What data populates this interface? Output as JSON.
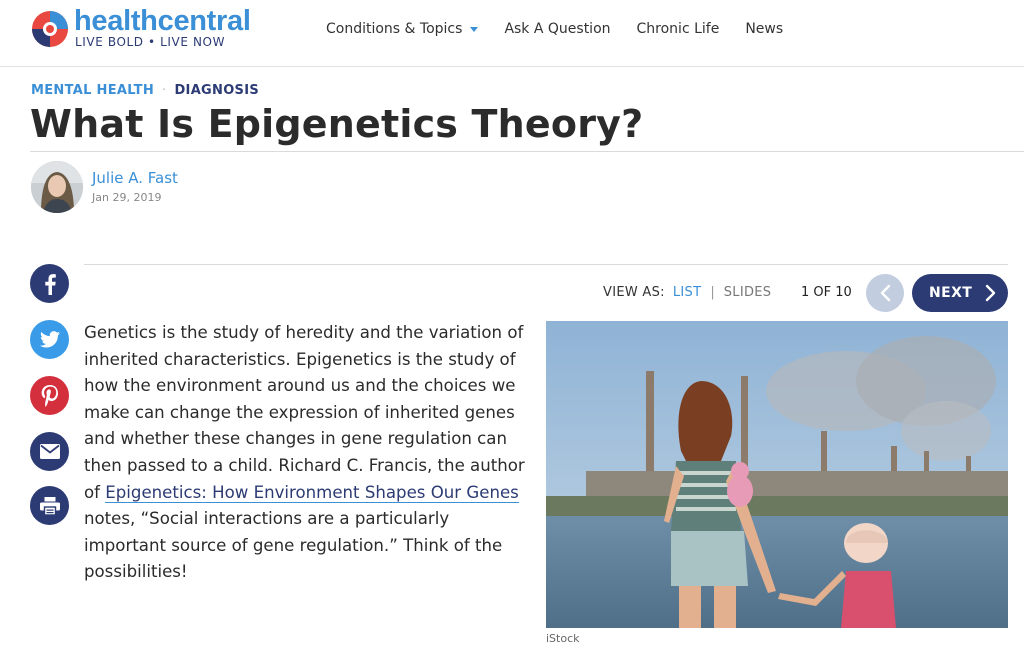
{
  "brand": {
    "name_part1": "health",
    "name_part2": "central",
    "tagline": "LIVE BOLD • LIVE NOW",
    "accent_color": "#3a8fd6",
    "navy_color": "#2c3b74"
  },
  "nav": {
    "items": [
      {
        "label": "Conditions & Topics",
        "has_dropdown": true
      },
      {
        "label": "Ask A Question"
      },
      {
        "label": "Chronic Life"
      },
      {
        "label": "News"
      }
    ]
  },
  "breadcrumb": {
    "category": "MENTAL HEALTH",
    "separator": "·",
    "subcategory": "DIAGNOSIS"
  },
  "article": {
    "title": "What Is Epigenetics Theory?",
    "author": "Julie A. Fast",
    "date": "Jan 29, 2019",
    "text_before_link": "Genetics is the study of heredity and the variation of inherited characteristics. Epigenetics is the study of how the environment around us and the choices we make can change the expression of inherited genes and whether these changes in gene regulation can then passed to a child. Richard C. Francis, the author of ",
    "link_text": "Epigenetics: How Environment Shapes Our Genes",
    "text_after_link": " notes, “Social interactions are a particularly important source of gene regulation.” Think of the possibilities!",
    "image_credit": "iStock"
  },
  "share": {
    "icons": [
      "facebook-icon",
      "twitter-icon",
      "pinterest-icon",
      "email-icon",
      "print-icon"
    ]
  },
  "viewer": {
    "view_as_label": "VIEW AS:",
    "list_label": "LIST",
    "divider": "|",
    "slides_label": "SLIDES",
    "counter": "1 OF 10",
    "next_label": "NEXT"
  }
}
